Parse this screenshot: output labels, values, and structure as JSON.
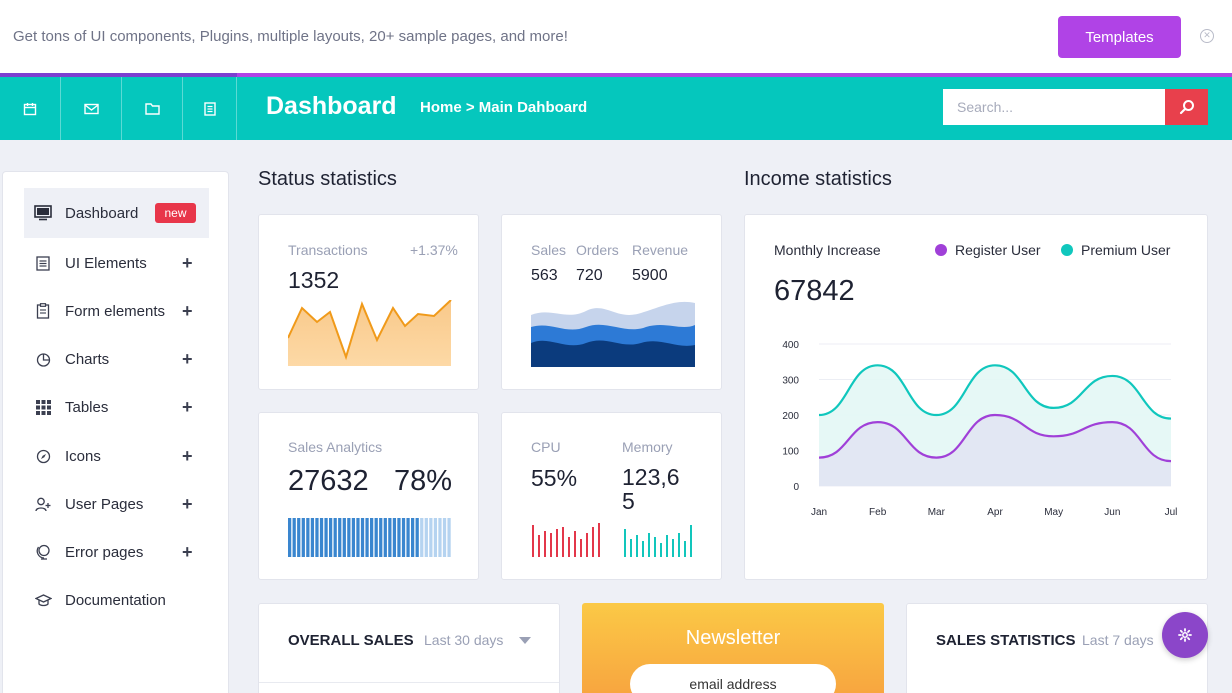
{
  "promo": {
    "text": "Get tons of UI components, Plugins, multiple layouts, 20+ sample pages, and more!",
    "button_label": "Templates",
    "close_icon": "close-icon"
  },
  "topbar": {
    "icons": [
      "calendar-icon",
      "mail-icon",
      "folder-icon",
      "document-icon"
    ],
    "title": "Dashboard",
    "breadcrumb": "Home > Main Dahboard",
    "search_placeholder": "Search...",
    "search_icon": "search-icon"
  },
  "sidebar": {
    "items": [
      {
        "label": "Dashboard",
        "icon": "monitor-icon",
        "badge": "new",
        "active": true
      },
      {
        "label": "UI Elements",
        "icon": "list-icon",
        "expand": "+"
      },
      {
        "label": "Form elements",
        "icon": "clipboard-icon",
        "expand": "+"
      },
      {
        "label": "Charts",
        "icon": "pie-chart-icon",
        "expand": "+"
      },
      {
        "label": "Tables",
        "icon": "grid-icon",
        "expand": "+"
      },
      {
        "label": "Icons",
        "icon": "compass-icon",
        "expand": "+"
      },
      {
        "label": "User Pages",
        "icon": "user-add-icon",
        "expand": "+"
      },
      {
        "label": "Error pages",
        "icon": "globe-icon",
        "expand": "+"
      },
      {
        "label": "Documentation",
        "icon": "graduation-cap-icon"
      }
    ]
  },
  "status": {
    "title": "Status statistics",
    "transactions": {
      "label": "Transactions",
      "change": "+1.37%",
      "value": "1352"
    },
    "sales_orders": {
      "labels": [
        "Sales",
        "Orders",
        "Revenue"
      ],
      "values": [
        "563",
        "720",
        "5900"
      ]
    },
    "sales_analytics": {
      "label": "Sales Analytics",
      "value": "27632",
      "percent": "78%"
    },
    "cpu": {
      "label": "CPU",
      "value": "55%"
    },
    "memory": {
      "label": "Memory",
      "value": "123,6\n5"
    }
  },
  "income": {
    "title": "Income statistics",
    "monthly_label": "Monthly Increase",
    "monthly_value": "67842",
    "legend": [
      {
        "name": "Register User",
        "color": "#a040d8"
      },
      {
        "name": "Premium User",
        "color": "#10c7bd"
      }
    ]
  },
  "chart_data": {
    "type": "area",
    "categories": [
      "Jan",
      "Feb",
      "Mar",
      "Apr",
      "May",
      "Jun",
      "Jul"
    ],
    "series": [
      {
        "name": "Premium User",
        "values": [
          200,
          340,
          200,
          340,
          220,
          310,
          190
        ],
        "color": "#10c7bd"
      },
      {
        "name": "Register User",
        "values": [
          80,
          180,
          80,
          200,
          140,
          180,
          70
        ],
        "color": "#a040d8"
      }
    ],
    "ylim": [
      0,
      400
    ],
    "yticks": [
      "400",
      "300",
      "200",
      "100",
      "0"
    ],
    "grid": true,
    "legend_placement": "top-right"
  },
  "bottom": {
    "overall_sales": {
      "title": "OVERALL SALES",
      "period": "Last 30 days"
    },
    "newsletter": {
      "title": "Newsletter",
      "input_text": "email address"
    },
    "sales_statistics": {
      "title": "SALES STATISTICS",
      "period": "Last 7 days"
    }
  },
  "colors": {
    "teal": "#05c7bd",
    "purple": "#b043e6",
    "red": "#e8404c",
    "orange": "#f5a623"
  }
}
